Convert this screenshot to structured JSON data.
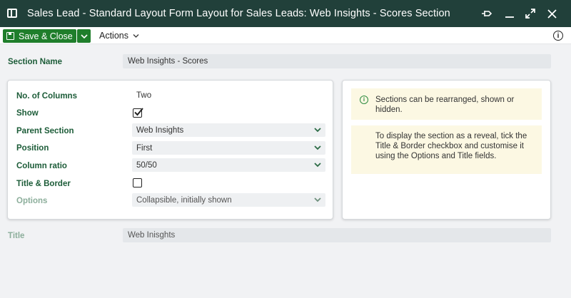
{
  "window": {
    "title": "Sales Lead - Standard Layout Form Layout for Sales Leads: Web Insights - Scores Section",
    "accent": "#21403a",
    "icons": [
      "app-window-icon",
      "pin-icon",
      "minimize-icon",
      "maximize-icon",
      "close-icon"
    ]
  },
  "toolbar": {
    "save_label": "Save & Close",
    "actions_label": "Actions",
    "info_label": "i",
    "save_color": "#1f7e2b"
  },
  "form": {
    "section_name_label": "Section Name",
    "section_name_value": "Web Insights - Scores",
    "title_label": "Title",
    "title_value": "Web Inisghts"
  },
  "settings": {
    "columns_label": "No. of Columns",
    "columns_value": "Two",
    "show_label": "Show",
    "show_checked": true,
    "parent_label": "Parent Section",
    "parent_value": "Web Insights",
    "position_label": "Position",
    "position_value": "First",
    "ratio_label": "Column ratio",
    "ratio_value": "50/50",
    "title_border_label": "Title & Border",
    "title_border_checked": false,
    "options_label": "Options",
    "options_value": "Collapsible, initially shown"
  },
  "help": {
    "note1": "Sections can be rearranged, shown or hidden.",
    "note2": "To display the section as a reveal, tick the Title & Border checkbox and customise it using the Options and Title fields."
  }
}
